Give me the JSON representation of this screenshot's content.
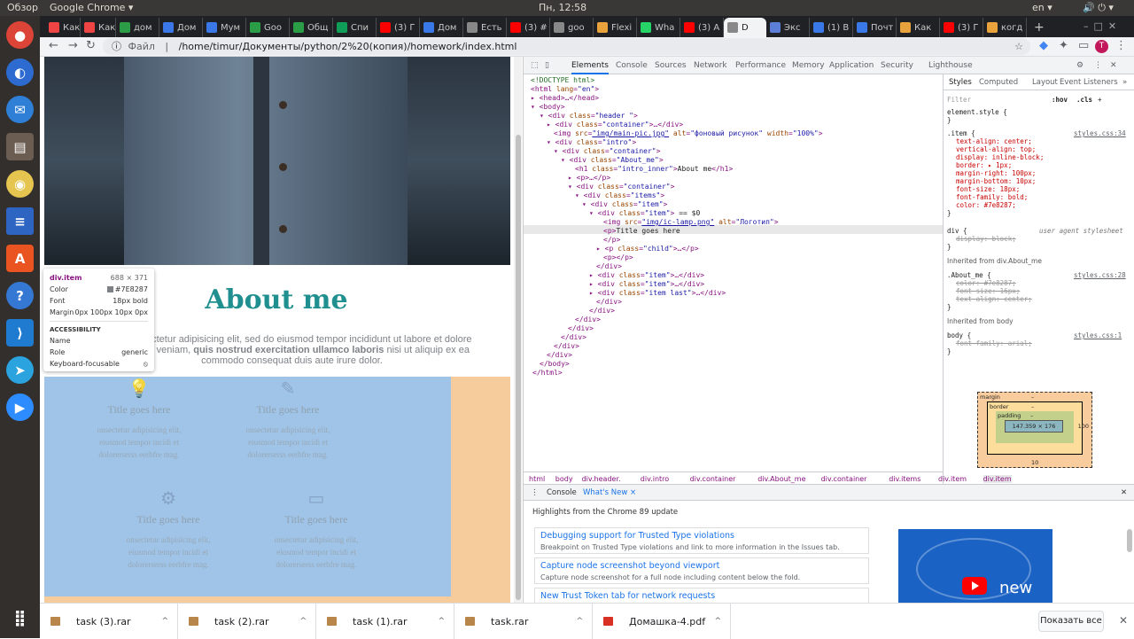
{
  "topbar": {
    "activities": "Обзор",
    "app": "Google Chrome ▾",
    "clock": "Пн, 12:58",
    "lang": "en ▾"
  },
  "tabs": [
    {
      "label": "Как",
      "color": "#e44"
    },
    {
      "label": "Как",
      "color": "#e44"
    },
    {
      "label": "дом",
      "color": "#2a9d46"
    },
    {
      "label": "Дом",
      "color": "#3b78e7"
    },
    {
      "label": "Мум",
      "color": "#3b78e7"
    },
    {
      "label": "Goo",
      "color": "#2a9d46"
    },
    {
      "label": "Общ",
      "color": "#2a9d46"
    },
    {
      "label": "Спи",
      "color": "#0f9d58"
    },
    {
      "label": "(3) Г",
      "color": "#f00"
    },
    {
      "label": "Дом",
      "color": "#3b78e7"
    },
    {
      "label": "Есть",
      "color": "#888"
    },
    {
      "label": "(3) #",
      "color": "#f00"
    },
    {
      "label": "goo",
      "color": "#888"
    },
    {
      "label": "Flexi",
      "color": "#e8a33d"
    },
    {
      "label": "Wha",
      "color": "#25d366"
    },
    {
      "label": "(3) A",
      "color": "#f00"
    },
    {
      "label": "D",
      "color": "#888",
      "active": true
    },
    {
      "label": "Экс",
      "color": "#5b7fd6"
    },
    {
      "label": "(1) В",
      "color": "#3b78e7"
    },
    {
      "label": "Почт",
      "color": "#3b78e7"
    },
    {
      "label": "Как",
      "color": "#e8a33d"
    },
    {
      "label": "(3) Г",
      "color": "#f00"
    },
    {
      "label": "когд",
      "color": "#e8a33d"
    }
  ],
  "omnibox": {
    "prefix": "Файл",
    "url": "/home/timur/Документы/python/2%20(копия)/homework/index.html"
  },
  "page": {
    "about_title": "About me",
    "about_line1": "et, consectetur adipisicing elit, sed do eiusmod tempor incididunt ut labore et dolore",
    "about_line2_pre": "ad minim veniam, ",
    "about_line2_bold": "quis nostrud exercitation ullamco laboris",
    "about_line2_post": " nisi ut aliquip ex ea",
    "about_line3": "commodo consequat duis aute irure dolor.",
    "items": [
      {
        "icon": "lamp-icon",
        "title": "Title goes here",
        "desc": [
          "onsectetur adipisicing elit,",
          "eiusmod tempor incidi et",
          "dolorerserss eerbfre mag."
        ]
      },
      {
        "icon": "pencil-icon",
        "title": "Title goes here",
        "desc": [
          "onsectetur adipisicing elit,",
          "eiusmod tempor incidi et",
          "dolorerserss eerbfre mag."
        ]
      },
      {
        "icon": "gear-icon",
        "title": "Title goes here",
        "desc": [
          "onsectetur adipisicing elit,",
          "eiusmod tempor incidi et",
          "dolorerserss eerbfre mag."
        ]
      },
      {
        "icon": "laptop-icon",
        "title": "Title goes here",
        "desc": [
          "onsectetur adipisicing elit,",
          "eiusmod tempor incidi et",
          "dolorerserss eerbfre mag."
        ]
      }
    ]
  },
  "tooltip": {
    "selector": "div.item",
    "size": "688 × 371",
    "color_label": "Color",
    "color": "#7E8287",
    "font_label": "Font",
    "font": "18px bold",
    "margin_label": "Margin",
    "margin": "0px 100px 10px 0px",
    "a11y": "ACCESSIBILITY",
    "name_label": "Name",
    "role_label": "Role",
    "role": "generic",
    "focus_label": "Keyboard-focusable"
  },
  "devtools": {
    "tabs": [
      "Elements",
      "Console",
      "Sources",
      "Network",
      "Performance",
      "Memory",
      "Application",
      "Security",
      "Lighthouse"
    ],
    "crumbs": [
      "html",
      "body",
      "div.header.",
      "div.intro",
      "div.container",
      "div.About_me",
      "div.container",
      "div.items",
      "div.item",
      "div.item"
    ],
    "styles_tabs": [
      "Styles",
      "Computed",
      "Layout",
      "Event Listeners"
    ],
    "filter": "Filter",
    "hov": ":hov",
    "cls": ".cls",
    "element_style": "element.style {",
    "rule_item": [
      ".item {",
      "text-align: center;",
      "vertical-align: top;",
      "display: inline-block;",
      "border: ▸ 1px;",
      "margin-right: 100px;",
      "margin-bottom: 10px;",
      "font-size: 18px;",
      "font-family: bold;",
      "color: #7e8287;"
    ],
    "rule_item_src": "styles.css:34",
    "rule_div": "div {",
    "rule_div_prop": "display: block;",
    "ua": "user agent stylesheet",
    "inherited1": "Inherited from div.About_me",
    "about_rule": [
      ".About_me {",
      "color: #7e8287;",
      "font-size: 16px;",
      "text-align: center;"
    ],
    "about_src": "styles.css:28",
    "inherited2": "Inherited from body",
    "body_rule": [
      "body {",
      "font-family: arial;"
    ],
    "body_src": "styles.css:1",
    "box": {
      "margin": "margin",
      "border": "border",
      "padding": "padding",
      "content": "147.359 × 176",
      "right": "100",
      "bottom": "10",
      "dash": "–"
    },
    "drawer_tabs": [
      "Console",
      "What's New ×"
    ],
    "highlights": "Highlights from the Chrome 89 update",
    "news": [
      {
        "h": "Debugging support for Trusted Type violations",
        "b": "Breakpoint on Trusted Type violations and link to more information in the Issues tab."
      },
      {
        "h": "Capture node screenshot beyond viewport",
        "b": "Capture node screenshot for a full node including content below the fold."
      },
      {
        "h": "New Trust Token tab for network requests",
        "b": "Display Trust Token requests and responses in the network panel."
      }
    ],
    "video_label": "new"
  },
  "downloads": [
    {
      "name": "task (3).rar"
    },
    {
      "name": "task (2).rar"
    },
    {
      "name": "task (1).rar"
    },
    {
      "name": "task.rar"
    },
    {
      "name": "Домашка-4.pdf"
    }
  ],
  "show_all": "Показать все"
}
